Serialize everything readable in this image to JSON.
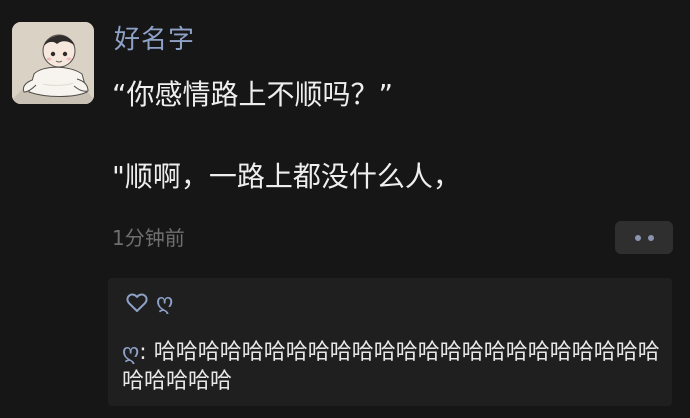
{
  "post": {
    "avatar_icon": "cartoon-baby-avatar",
    "author": "好名字",
    "lines": [
      "“你感情路上不顺吗？”",
      "\"顺啊，一路上都没什么人，"
    ],
    "timestamp": "1分钟前",
    "more_icon": "two-dots-icon"
  },
  "likes": {
    "icon": "heart-outline-icon",
    "names": "ღ"
  },
  "comment": {
    "author": "ღ",
    "separator": ": ",
    "text": "哈哈哈哈哈哈哈哈哈哈哈哈哈哈哈哈哈哈哈哈哈哈哈哈哈哈哈哈"
  },
  "colors": {
    "background": "#161616",
    "name_link": "#8ea1c7",
    "text": "#eeeeee",
    "muted": "#6f6f6f",
    "panel": "#1f1f1f"
  }
}
